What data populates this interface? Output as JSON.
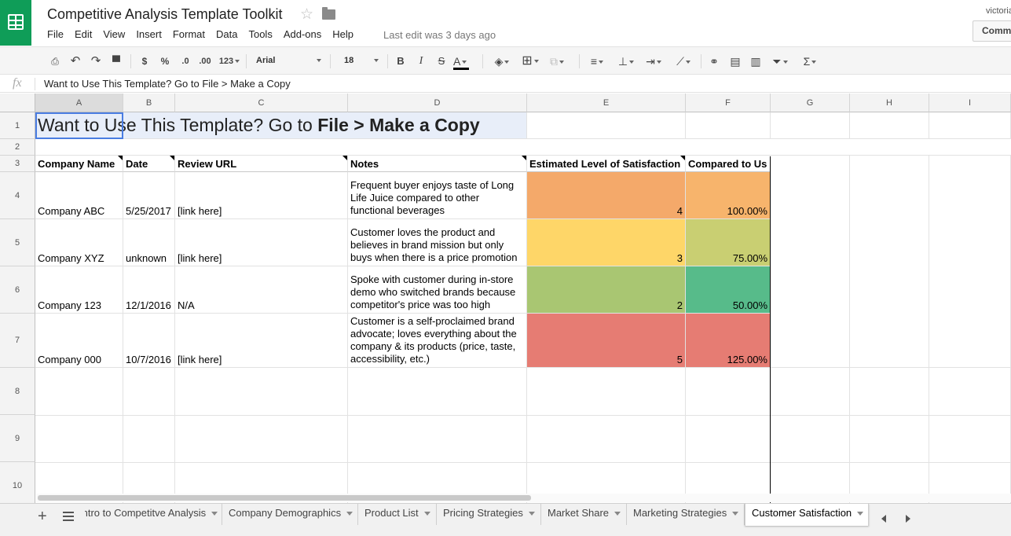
{
  "header": {
    "title": "Competitive Analysis Template Toolkit",
    "menu": [
      "File",
      "Edit",
      "View",
      "Insert",
      "Format",
      "Data",
      "Tools",
      "Add-ons",
      "Help"
    ],
    "last_edit": "Last edit was 3 days ago",
    "user": "victoria",
    "comments_label": "Comments"
  },
  "toolbar": {
    "currency": "$",
    "percent": "%",
    "dec_less": ".0",
    "dec_more": ".00",
    "more_formats": "123",
    "font": "Arial",
    "size": "18",
    "bold": "B",
    "italic": "I",
    "strike": "S",
    "text_color": "A",
    "function": "Σ"
  },
  "formula": {
    "icon": "fx",
    "value": "Want to Use This Template? Go to File > Make a Copy"
  },
  "columns": [
    "A",
    "B",
    "C",
    "D",
    "E",
    "F",
    "G",
    "H",
    "I"
  ],
  "rows": [
    "1",
    "2",
    "3",
    "4",
    "5",
    "6",
    "7",
    "8",
    "9",
    "10"
  ],
  "sheet": {
    "title_plain": "Want to Use This Template? Go to ",
    "title_bold": "File > Make a Copy",
    "headers": [
      "Company Name",
      "Date",
      "Review URL",
      "Notes",
      "Estimated Level of Satisfaction",
      "Compared to Us"
    ],
    "records": [
      {
        "company": "Company ABC",
        "date": "5/25/2017",
        "url": "[link here]",
        "notes": "Frequent buyer enjoys taste of Long Life Juice compared to other functional beverages",
        "satisfaction": "4",
        "compared": "100.00%",
        "sat_color": "#f4a96a",
        "cmp_color": "#f7b46c"
      },
      {
        "company": "Company XYZ",
        "date": "unknown",
        "url": "[link here]",
        "notes": "Customer loves the product and believes in brand mission but only buys when there is a price promotion",
        "satisfaction": "3",
        "compared": "75.00%",
        "sat_color": "#fed668",
        "cmp_color": "#c9cf72"
      },
      {
        "company": "Company 123",
        "date": "12/1/2016",
        "url": "N/A",
        "notes": "Spoke with customer during in-store demo who switched brands because competitor's price was too high",
        "satisfaction": "2",
        "compared": "50.00%",
        "sat_color": "#a9c672",
        "cmp_color": "#57bb8a"
      },
      {
        "company": "Company 000",
        "date": "10/7/2016",
        "url": "[link here]",
        "notes": "Customer is a self-proclaimed brand advocate; loves everything about the company & its products (price, taste, accessibility, etc.)",
        "satisfaction": "5",
        "compared": "125.00%",
        "sat_color": "#e67c73",
        "cmp_color": "#e67c73"
      }
    ]
  },
  "tabs": [
    {
      "label": "Intro to Competitve Analysis",
      "active": false
    },
    {
      "label": "Company Demographics",
      "active": false
    },
    {
      "label": "Product List",
      "active": false
    },
    {
      "label": "Pricing Strategies",
      "active": false
    },
    {
      "label": "Market Share",
      "active": false
    },
    {
      "label": "Marketing Strategies",
      "active": false
    },
    {
      "label": "Customer Satisfaction",
      "active": true
    }
  ]
}
